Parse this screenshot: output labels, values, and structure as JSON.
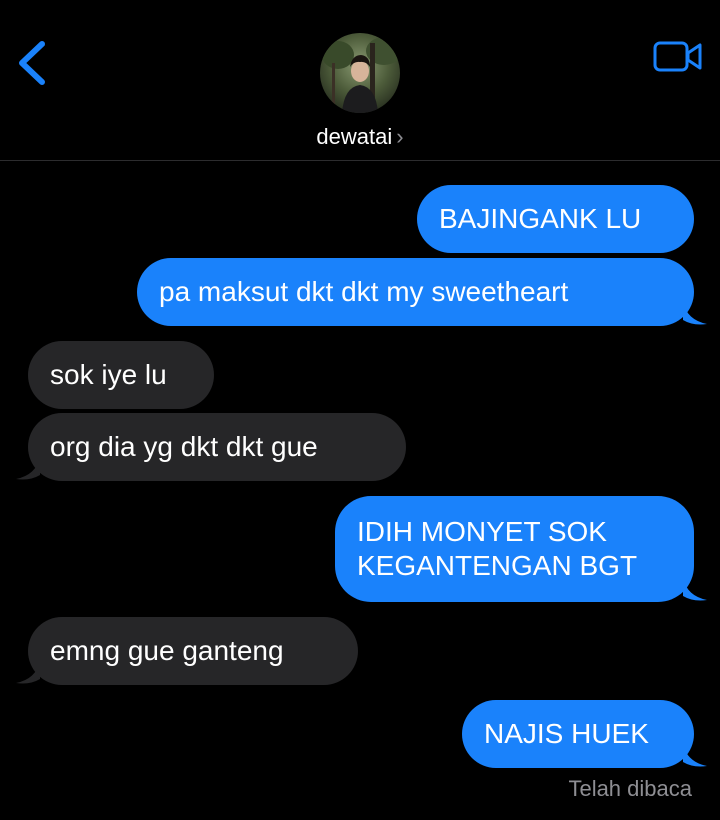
{
  "header": {
    "contact_name": "dewatai",
    "chevron": "›",
    "back_icon": "chevron-left-icon",
    "video_icon": "video-camera-icon"
  },
  "colors": {
    "outgoing": "#1a82fb",
    "incoming": "#262628",
    "accent": "#1a82fb",
    "background": "#000000"
  },
  "messages": [
    {
      "direction": "outgoing",
      "text": "BAJINGANK LU"
    },
    {
      "direction": "outgoing",
      "text": "pa maksut dkt dkt my sweetheart"
    },
    {
      "direction": "incoming",
      "text": "sok iye lu"
    },
    {
      "direction": "incoming",
      "text": "org dia yg dkt dkt gue"
    },
    {
      "direction": "outgoing",
      "text_lines": [
        "IDIH MONYET SOK",
        "KEGANTENGAN BGT"
      ]
    },
    {
      "direction": "incoming",
      "text": "emng gue ganteng"
    },
    {
      "direction": "outgoing",
      "text": "NAJIS HUEK"
    }
  ],
  "receipt": "Telah dibaca"
}
